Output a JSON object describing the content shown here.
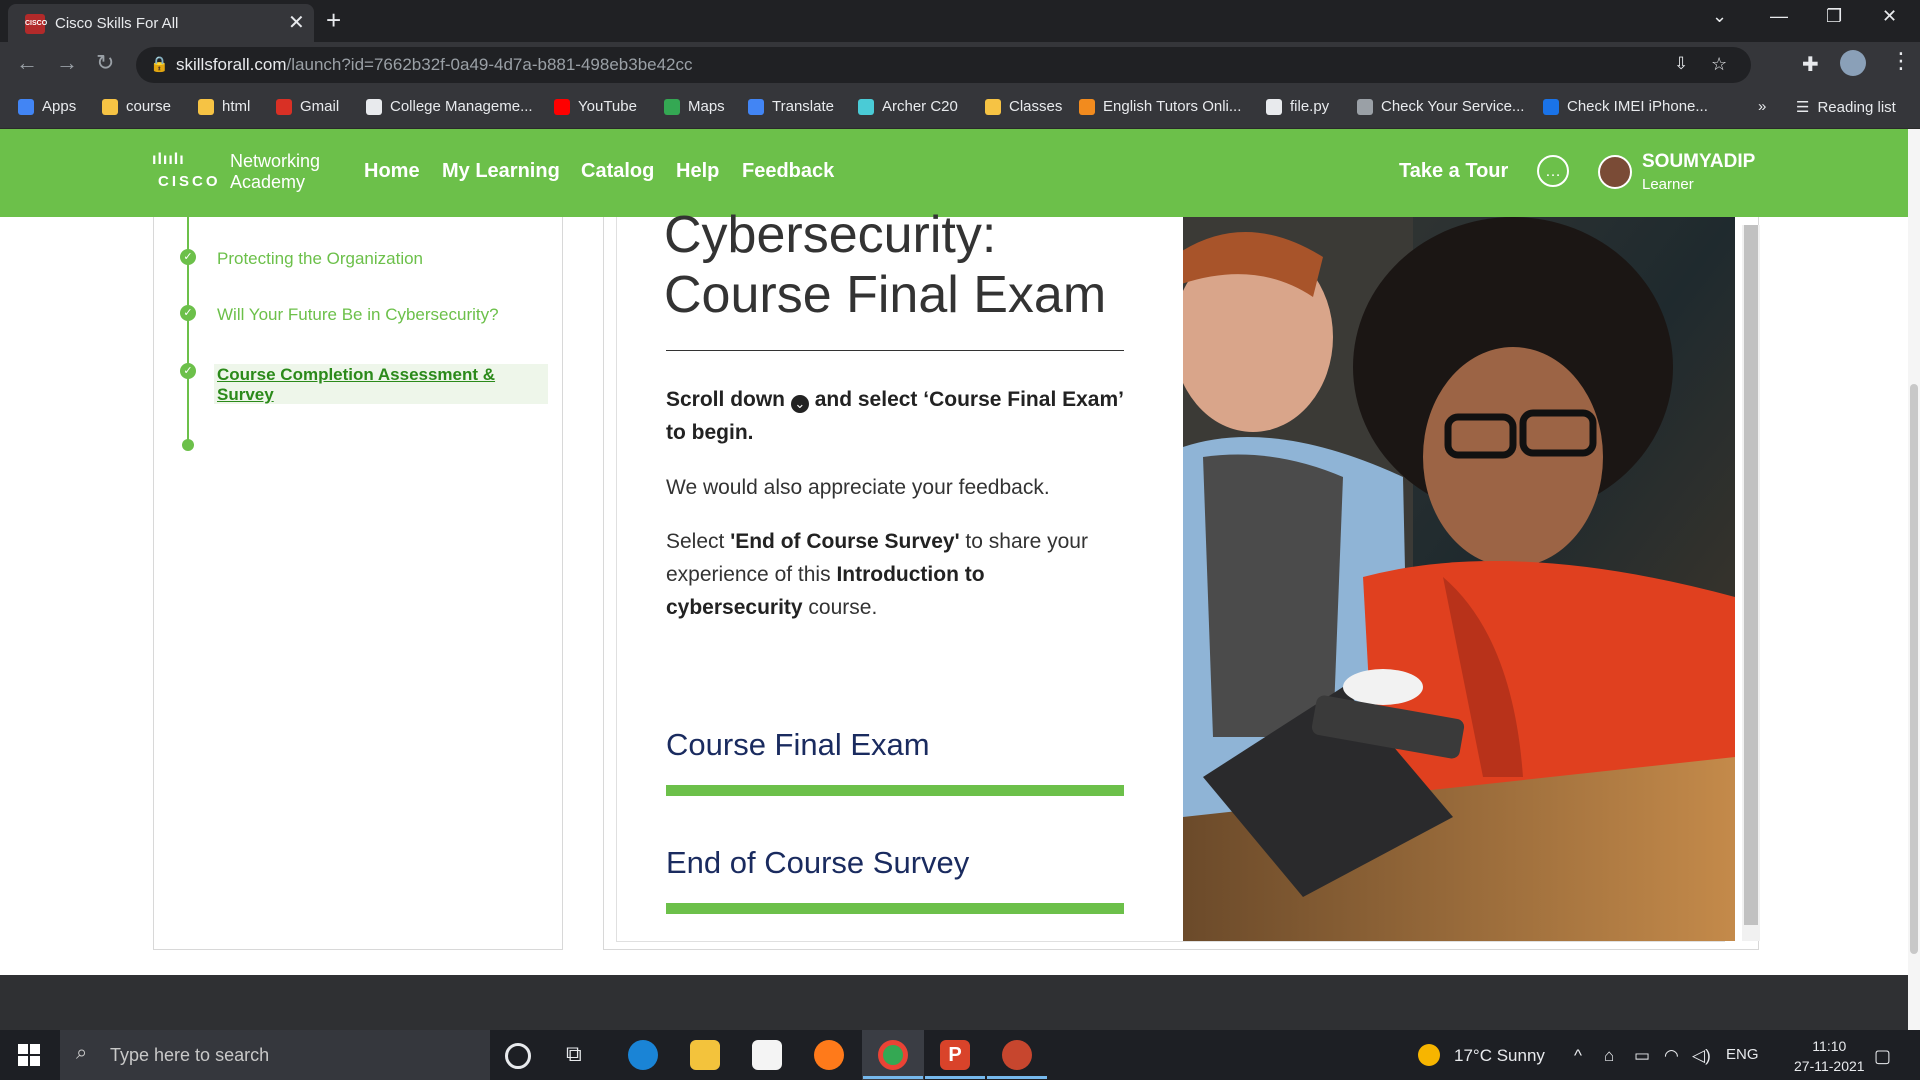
{
  "browser": {
    "tab_title": "Cisco Skills For All",
    "tab_favicon_text": "CISCO",
    "url_host": "skillsforall.com",
    "url_path": "/launch?id=7662b32f-0a49-4d7a-b881-498eb3be42cc",
    "bookmarks": [
      {
        "label": "Apps",
        "icon": "apps-grid-icon",
        "color": "#4285f4"
      },
      {
        "label": "course",
        "icon": "folder-icon",
        "color": "#f6c344"
      },
      {
        "label": "html",
        "icon": "folder-icon",
        "color": "#f6c344"
      },
      {
        "label": "Gmail",
        "icon": "gmail-icon",
        "color": "#d93025"
      },
      {
        "label": "College Manageme...",
        "icon": "globe-icon",
        "color": "#e8eaed"
      },
      {
        "label": "YouTube",
        "icon": "youtube-icon",
        "color": "#ff0000"
      },
      {
        "label": "Maps",
        "icon": "maps-pin-icon",
        "color": "#34a853"
      },
      {
        "label": "Translate",
        "icon": "translate-icon",
        "color": "#4285f4"
      },
      {
        "label": "Archer C20",
        "icon": "tplink-icon",
        "color": "#4acbd6"
      },
      {
        "label": "Classes",
        "icon": "classroom-icon",
        "color": "#f6c344"
      },
      {
        "label": "English Tutors Onli...",
        "icon": "tutor-icon",
        "color": "#f28b1e"
      },
      {
        "label": "file.py",
        "icon": "globe-icon",
        "color": "#e8eaed"
      },
      {
        "label": "Check Your Service...",
        "icon": "apple-icon",
        "color": "#9aa0a6"
      },
      {
        "label": "Check IMEI iPhone...",
        "icon": "imei-icon",
        "color": "#1a73e8"
      }
    ],
    "overflow_label": "»",
    "reading_list_label": "Reading list"
  },
  "nav": {
    "logo_bars": "ılıılı",
    "logo_cisco": "CISCO",
    "logo_line1": "Networking",
    "logo_line2": "Academy",
    "links": [
      "Home",
      "My Learning",
      "Catalog",
      "Help",
      "Feedback"
    ],
    "take_tour": "Take a Tour",
    "user_name": "SOUMYADIP",
    "user_role": "Learner"
  },
  "sidebar": {
    "items": [
      {
        "label": "Protecting the Organization",
        "done": true
      },
      {
        "label": "Will Your Future Be in Cybersecurity?",
        "done": true
      }
    ],
    "active_item": {
      "line1": "Course Completion Assessment &",
      "line2": "Survey",
      "done": true
    }
  },
  "content": {
    "title_line1": "Cybersecurity:",
    "title_line2": "Course Final Exam",
    "instr_bold_1": "Scroll down",
    "instr_bold_2": "and select ‘Course Final Exam’ to begin.",
    "feedback_text": "We would also appreciate your feedback.",
    "survey_pre": "Select ",
    "survey_bold": "'End of Course Survey'",
    "survey_mid": " to share your experience of this ",
    "survey_course_bold": "Introduction to cybersecurity",
    "survey_post": " course.",
    "link_exam": "Course Final Exam",
    "link_survey": "End of Course Survey"
  },
  "taskbar": {
    "search_placeholder": "Type here to search",
    "weather": "17°C  Sunny",
    "lang": "ENG",
    "time": "11:10",
    "date": "27-11-2021"
  },
  "colors": {
    "accent_green": "#6cc04a",
    "navy": "#1a2b5f"
  }
}
